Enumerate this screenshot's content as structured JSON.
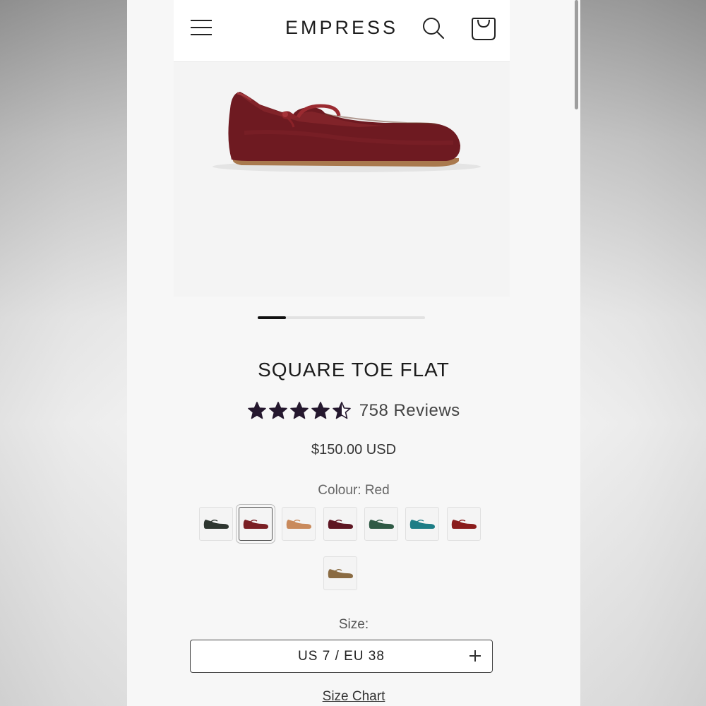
{
  "header": {
    "logo": "EMPRESS"
  },
  "gallery": {
    "slide_progress": 0.17
  },
  "product": {
    "title": "SQUARE TOE FLAT",
    "rating": 4.5,
    "reviews_label": "758 Reviews",
    "price": "$150.00 USD",
    "colour_label": "Colour: Red",
    "swatches": [
      {
        "name": "black",
        "color": "#2e3630"
      },
      {
        "name": "red-selected",
        "color": "#7a1f24"
      },
      {
        "name": "tan",
        "color": "#c98a5c"
      },
      {
        "name": "burgundy-patent",
        "color": "#5e1622"
      },
      {
        "name": "green",
        "color": "#2f5a45"
      },
      {
        "name": "teal",
        "color": "#1d7d86"
      },
      {
        "name": "red-patent",
        "color": "#8a1c1c"
      },
      {
        "name": "leopard",
        "color": "#8a6b42"
      }
    ],
    "size_label": "Size:",
    "size_value": "US 7 / EU 38",
    "size_chart_label": "Size Chart"
  },
  "colors": {
    "star": "#25182e",
    "shoe": "#6e1a21"
  }
}
